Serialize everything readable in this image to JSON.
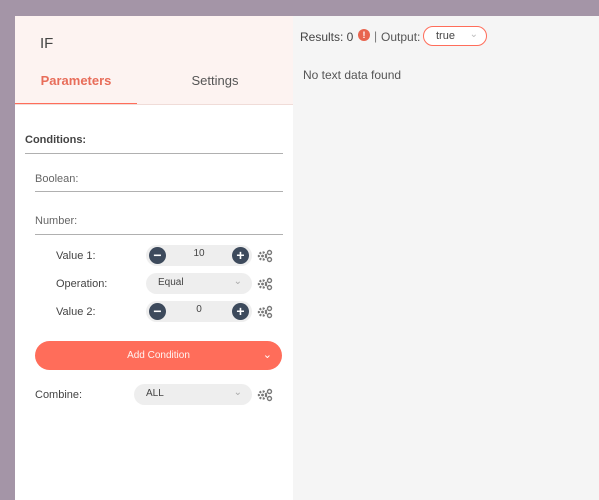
{
  "node": {
    "title": "IF"
  },
  "tabs": {
    "parameters": "Parameters",
    "settings": "Settings"
  },
  "params": {
    "conditions_label": "Conditions:",
    "boolean_label": "Boolean:",
    "number_label": "Number:",
    "value1_label": "Value 1:",
    "value1": "10",
    "operation_label": "Operation:",
    "operation": "Equal",
    "value2_label": "Value 2:",
    "value2": "0",
    "add_condition": "Add Condition",
    "combine_label": "Combine:",
    "combine": "ALL"
  },
  "output": {
    "results_label": "Results: 0",
    "info": "!",
    "separator": "|",
    "output_label": "Output:",
    "output_value": "true",
    "empty_message": "No text data found"
  },
  "icons": {
    "minus": "−",
    "plus": "+",
    "chevron": "⌄"
  },
  "colors": {
    "accent": "#ff6d5a",
    "stepper_button": "#3d4a5c"
  }
}
